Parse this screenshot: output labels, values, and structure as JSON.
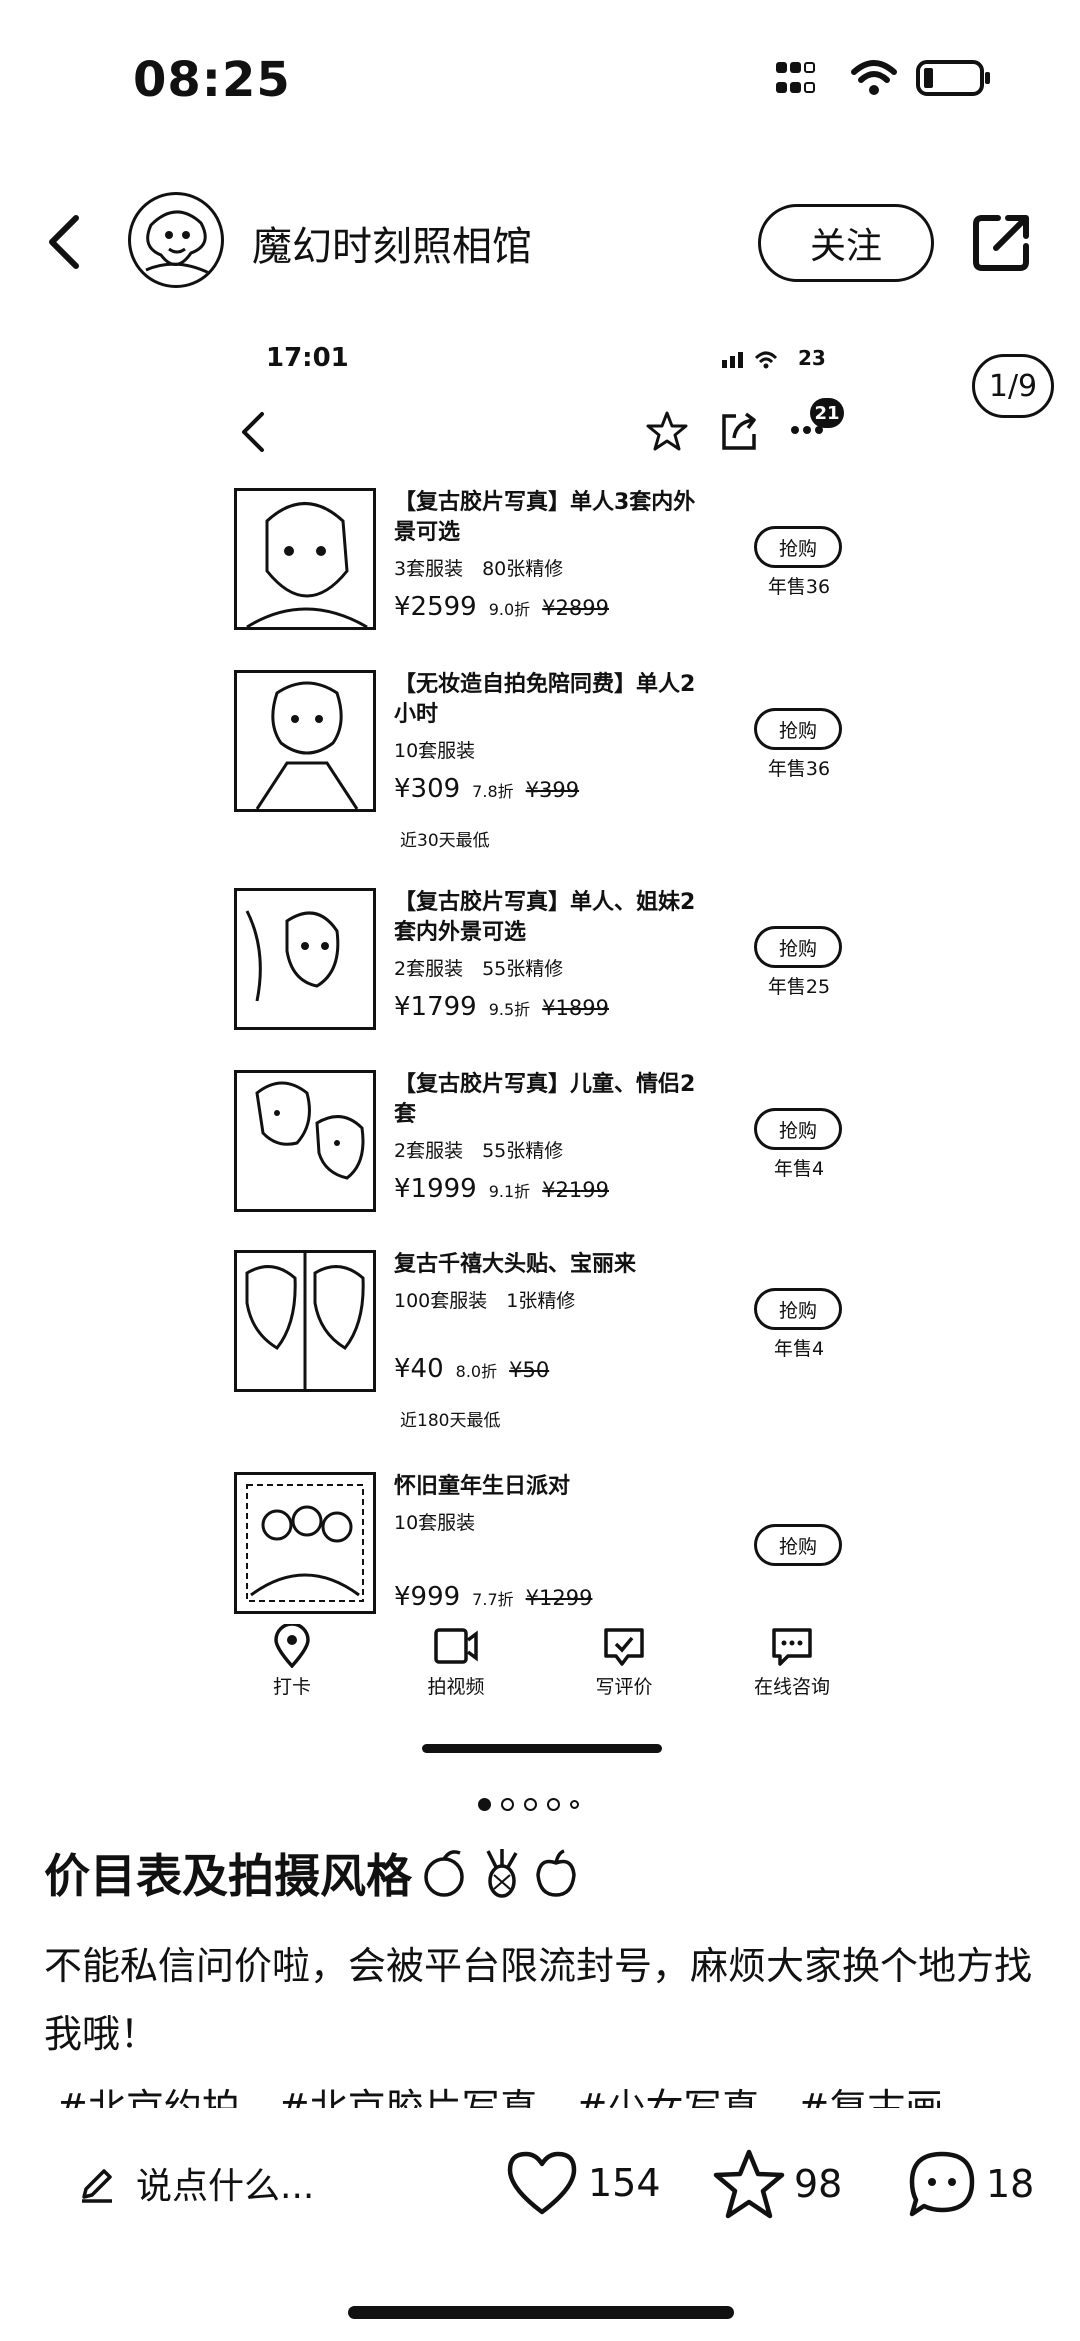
{
  "status_bar": {
    "time": "08:25"
  },
  "header": {
    "shop_name": "魔幻时刻照相馆",
    "follow_label": "关注",
    "page_indicator": "1/9"
  },
  "inner_screenshot": {
    "status_time": "17:01",
    "battery": "23",
    "more_badge": "21",
    "items": [
      {
        "title": "【复古胶片写真】单人3套内外景可选",
        "spec": "3套服装　80张精修",
        "price": "¥2599",
        "discount": "9.0折",
        "original": "¥2899",
        "low_note": "",
        "buy_label": "抢购",
        "sales": "年售36"
      },
      {
        "title": "【无妆造自拍免陪同费】单人2小时",
        "spec": "10套服装",
        "price": "¥309",
        "discount": "7.8折",
        "original": "¥399",
        "low_note": "近30天最低",
        "buy_label": "抢购",
        "sales": "年售36"
      },
      {
        "title": "【复古胶片写真】单人、姐妹2套内外景可选",
        "spec": "2套服装　55张精修",
        "price": "¥1799",
        "discount": "9.5折",
        "original": "¥1899",
        "low_note": "",
        "buy_label": "抢购",
        "sales": "年售25"
      },
      {
        "title": "【复古胶片写真】儿童、情侣2套",
        "spec": "2套服装　55张精修",
        "price": "¥1999",
        "discount": "9.1折",
        "original": "¥2199",
        "low_note": "",
        "buy_label": "抢购",
        "sales": "年售4"
      },
      {
        "title": "复古千禧大头贴、宝丽来",
        "spec": "100套服装　1张精修",
        "price": "¥40",
        "discount": "8.0折",
        "original": "¥50",
        "low_note": "近180天最低",
        "buy_label": "抢购",
        "sales": "年售4"
      },
      {
        "title": "怀旧童年生日派对",
        "spec": "10套服装",
        "price": "¥999",
        "discount": "7.7折",
        "original": "¥1299",
        "low_note": "",
        "buy_label": "抢购",
        "sales": ""
      }
    ],
    "nav": [
      {
        "label": "打卡",
        "icon": "location-pin-icon"
      },
      {
        "label": "拍视频",
        "icon": "video-camera-icon"
      },
      {
        "label": "写评价",
        "icon": "review-icon"
      },
      {
        "label": "在线咨询",
        "icon": "chat-icon"
      }
    ]
  },
  "post": {
    "title": "价目表及拍摄风格",
    "body": "不能私信问价啦，会被平台限流封号，麻烦大家换个地方找我哦！",
    "tags": "#北京约拍　#北京胶片写真　#少女写真　#复古画"
  },
  "bottom_bar": {
    "comment_placeholder": "说点什么...",
    "likes": "154",
    "favorites": "98",
    "comments": "18"
  }
}
